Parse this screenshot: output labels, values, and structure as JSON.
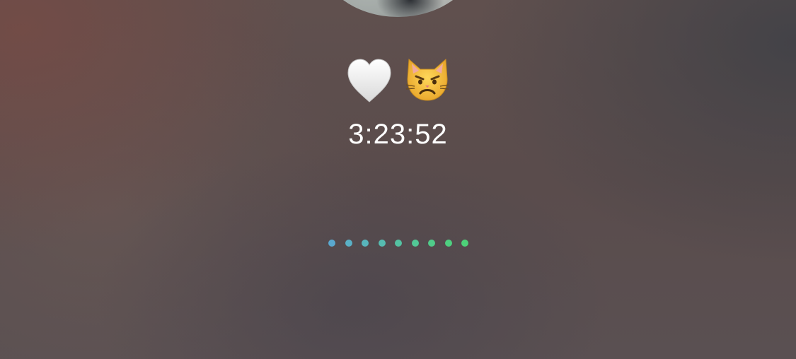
{
  "call": {
    "avatar_icon": "caller-avatar",
    "emojis": [
      {
        "icon": "white-heart-icon",
        "glyph": "🤍"
      },
      {
        "icon": "pouting-cat-icon",
        "glyph": "😾"
      }
    ],
    "duration": "3:23:52"
  },
  "progress_dots": {
    "count": 9,
    "colors": [
      "#5aa8cf",
      "#5ab0c6",
      "#58b6bc",
      "#56bcb0",
      "#54c2a2",
      "#52c896",
      "#50cc8a",
      "#4ecf80",
      "#4dd279"
    ]
  },
  "colors": {
    "text": "#ffffff",
    "background": "#5d4f4d"
  }
}
